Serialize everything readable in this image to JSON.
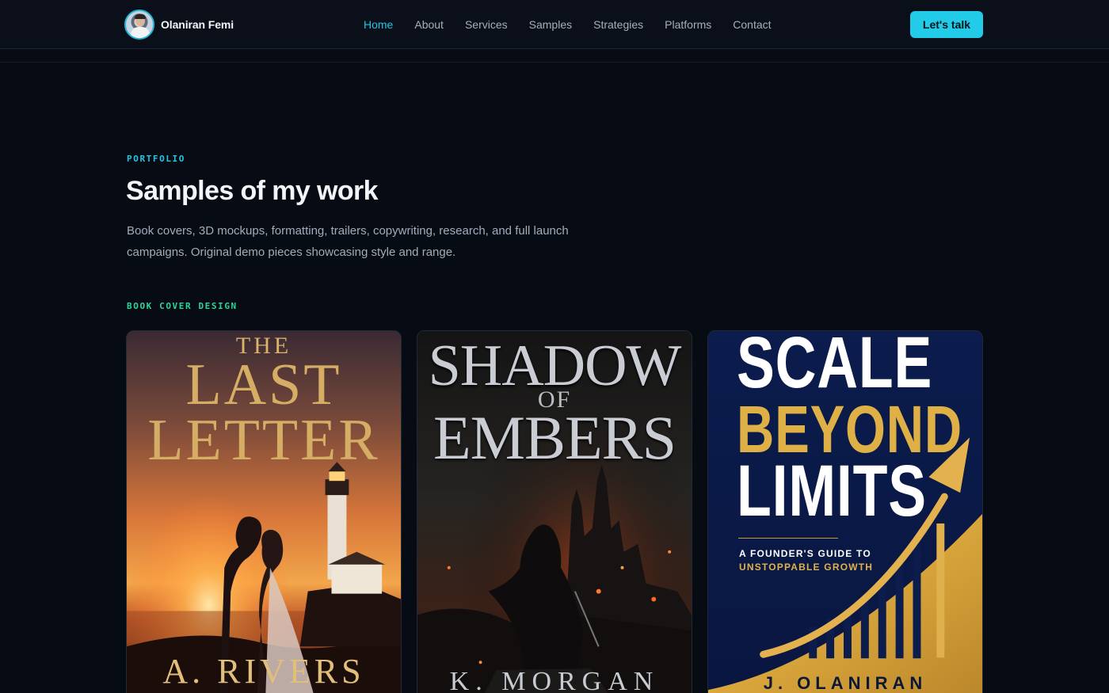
{
  "header": {
    "brand_name": "Olaniran Femi",
    "nav": [
      {
        "label": "Home",
        "active": true
      },
      {
        "label": "About"
      },
      {
        "label": "Services"
      },
      {
        "label": "Samples"
      },
      {
        "label": "Strategies"
      },
      {
        "label": "Platforms"
      },
      {
        "label": "Contact"
      }
    ],
    "cta_label": "Let's talk"
  },
  "section": {
    "eyebrow": "PORTFOLIO",
    "title": "Samples of my work",
    "description": "Book covers, 3D mockups, formatting, trailers, copywriting, research, and full launch campaigns. Original demo pieces showcasing style and range.",
    "category": "BOOK COVER DESIGN"
  },
  "covers": [
    {
      "line_the": "THE",
      "line1": "LAST",
      "line2": "LETTER",
      "author": "A. RIVERS"
    },
    {
      "line1": "SHADOW",
      "line_of": "OF",
      "line2": "EMBERS",
      "author": "K. MORGAN"
    },
    {
      "line1": "SCALE",
      "line2": "BEYOND",
      "line3": "LIMITS",
      "tagline1": "A FOUNDER'S GUIDE TO",
      "tagline2": "UNSTOPPABLE GROWTH",
      "author": "J. OLANIRAN"
    }
  ],
  "colors": {
    "accent": "#22cbe8",
    "category_accent": "#2fd49a",
    "background": "#070b14",
    "gold": "#dfb045"
  }
}
